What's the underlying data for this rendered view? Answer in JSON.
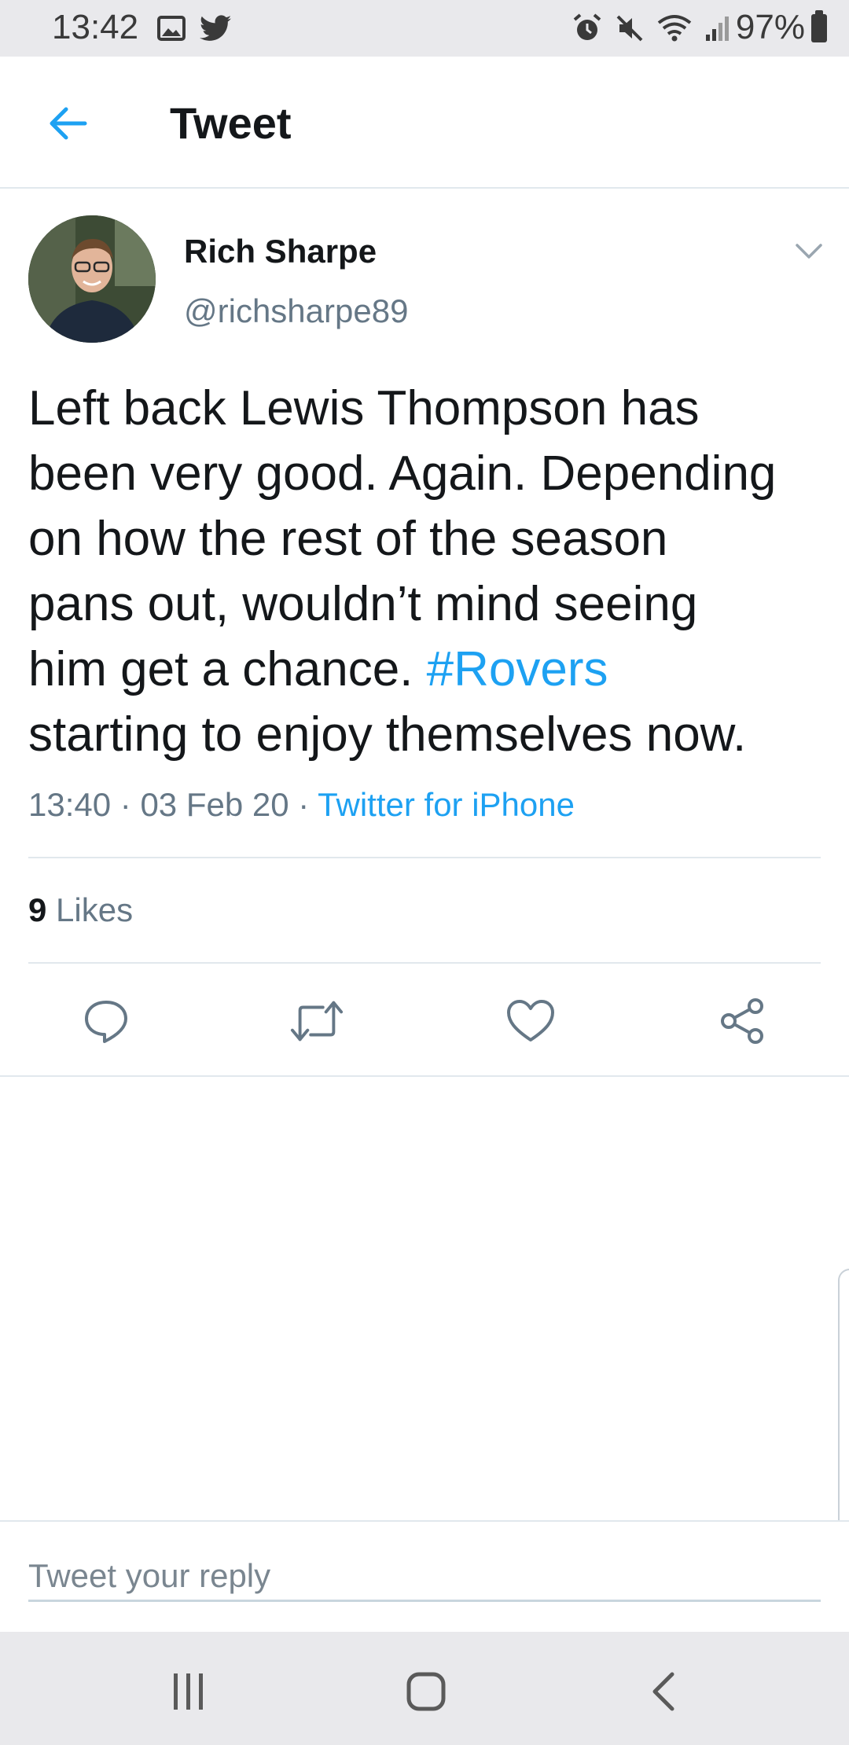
{
  "status_bar": {
    "time": "13:42",
    "battery": "97%",
    "left_icons": [
      "image-icon",
      "twitter-bird-icon"
    ],
    "right_icons": [
      "alarm-icon",
      "mute-icon",
      "wifi-icon",
      "signal-icon",
      "battery-icon"
    ]
  },
  "header": {
    "title": "Tweet",
    "back_icon": "back-arrow-icon"
  },
  "tweet": {
    "author_name": "Rich Sharpe",
    "author_handle": "@richsharpe89",
    "text_lines": [
      "Left back Lewis Thompson has",
      "been very good. Again. Depending",
      "on how the rest of the season",
      "pans out, wouldn’t mind seeing",
      "him get a chance. ",
      "starting to enjoy themselves now."
    ],
    "hashtag": "#Rovers",
    "time": "13:40",
    "date": "03 Feb 20",
    "separator": " · ",
    "source": "Twitter for iPhone",
    "likes_count": "9",
    "likes_label": " Likes"
  },
  "actions": [
    {
      "name": "reply",
      "icon": "comment-icon"
    },
    {
      "name": "retweet",
      "icon": "retweet-icon"
    },
    {
      "name": "like",
      "icon": "heart-icon"
    },
    {
      "name": "share",
      "icon": "share-icon"
    }
  ],
  "reply": {
    "placeholder": "Tweet your reply"
  },
  "colors": {
    "accent": "#1da1f2",
    "text_primary": "#14171a",
    "text_secondary": "#657786",
    "divider": "#e1e8ed",
    "system_bar": "#e9e9ec"
  }
}
